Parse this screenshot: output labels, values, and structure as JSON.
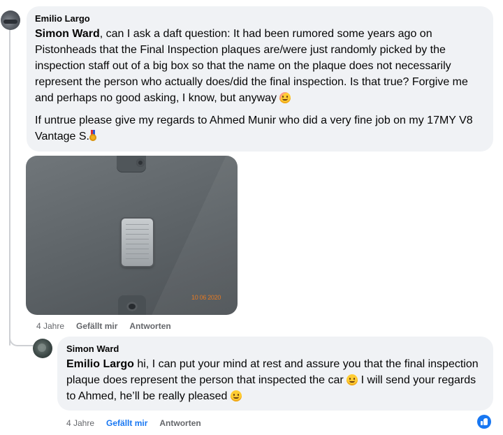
{
  "comments": [
    {
      "author": "Emilio Largo",
      "paragraphs": [
        {
          "mention": "Simon Ward",
          "text": ", can I ask a daft question: It had been rumored some years ago on Pistonheads that the Final Inspection plaques are/were just randomly picked by the inspection staff out of a big box so that the name on the plaque does not necessarily represent the person who actually does/did the final inspection. Is that true? Forgive me and perhaps no good asking, I know, but anyway",
          "emoji": "winking-face-emoji"
        },
        {
          "text": "If untrue please give my regards to Ahmed Munir who did a very fine job on my 17MY V8 Vantage S.",
          "emoji": "medal-emoji"
        }
      ],
      "photo": {
        "date_stamp": "10 06 2020",
        "alt": "final inspection plaque photo"
      },
      "actions": {
        "age": "4 Jahre",
        "like": "Gefällt mir",
        "reply": "Antworten"
      }
    },
    {
      "author": "Simon Ward",
      "paragraphs": [
        {
          "mention": "Emilio Largo",
          "text_1": " hi, I can put your mind at rest and assure you that the final inspection plaque does represent the person that inspected the car ",
          "text_2": " I will send your regards to Ahmed, he’ll be really pleased ",
          "emoji": "smiling-face-emoji"
        }
      ],
      "actions": {
        "age": "4 Jahre",
        "like": "Gefällt mir",
        "reply": "Antworten",
        "like_active": true
      },
      "reaction": {
        "type": "like",
        "icon": "thumbs-up-icon",
        "color": "#1877f2"
      }
    }
  ],
  "colors": {
    "bubble": "#f0f2f5",
    "link_active": "#1877f2",
    "meta": "#65676b"
  }
}
